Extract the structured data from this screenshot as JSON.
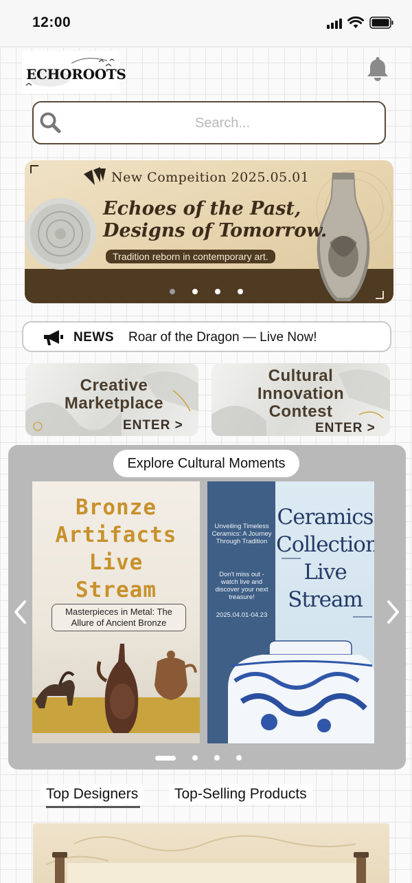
{
  "status_bar": {
    "time": "12:00"
  },
  "header": {
    "logo_text": "ECHOROOTS"
  },
  "search": {
    "placeholder": "Search..."
  },
  "banner": {
    "kicker": "New Compeition 2025.05.01",
    "headline_line1": "Echoes of the Past,",
    "headline_line2": "Designs of Tomorrow.",
    "tagline": "Tradition reborn in contemporary art.",
    "dots_count": 4,
    "active_dot": 0
  },
  "news": {
    "label": "NEWS",
    "text": "Roar of the Dragon — Live Now!"
  },
  "cards": [
    {
      "title_line1": "Creative",
      "title_line2": "Marketplace",
      "enter": "ENTER >"
    },
    {
      "title_line1": "Cultural",
      "title_line2": "Innovation",
      "title_line3": "Contest",
      "enter": "ENTER >"
    }
  ],
  "explore": {
    "title": "Explore Cultural Moments",
    "poster1": {
      "title_line1": "Bronze",
      "title_line2": "Artifacts",
      "title_line3": "Live",
      "title_line4": "Stream",
      "subtitle": "Masterpieces in Metal: The Allure of Ancient Bronze"
    },
    "poster2": {
      "side_title": "Unveiling Timeless Ceramics: A Journey Through Tradition",
      "side_cta": "Don't miss out - watch live and discover your next treasure!",
      "side_date": "2025.04.01-04.23",
      "title_line1": "Ceramics",
      "title_line2": "Collection",
      "title_line3": "Live",
      "title_line4": "Stream"
    },
    "dots_count": 4,
    "active_dot": 0
  },
  "tabs": [
    {
      "label": "Top Designers",
      "active": true
    },
    {
      "label": "Top-Selling Products",
      "active": false
    }
  ],
  "colors": {
    "accent_brown": "#4f3b22",
    "bronze_gold": "#c8912d",
    "ceramic_blue": "#253b68",
    "panel_gray": "#b9b9b9"
  }
}
